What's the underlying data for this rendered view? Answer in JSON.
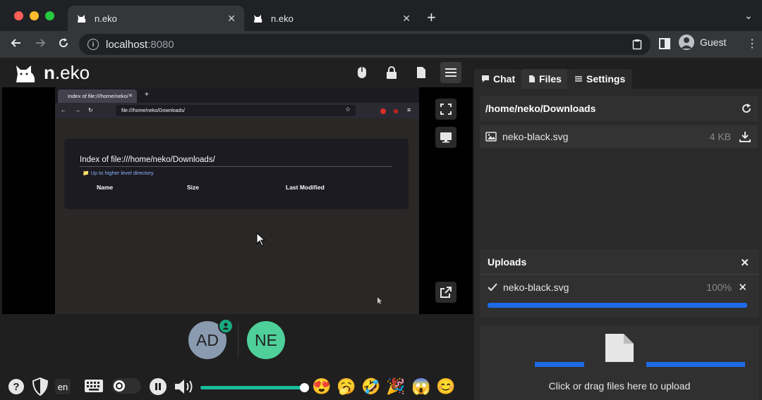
{
  "browser": {
    "tabs": [
      {
        "title": "n.eko",
        "active": true
      },
      {
        "title": "n.eko",
        "active": false
      }
    ],
    "url_host": "localhost",
    "url_port": ":8080",
    "profile": "Guest"
  },
  "app": {
    "logo_bold": "n",
    "logo_rest": ".eko",
    "remote_browser": {
      "tab_title": "Index of file:///home/neko/",
      "url": "file:///home/neko/Downloads/",
      "page_title": "Index of file:///home/neko/Downloads/",
      "up_link": "Up to higher level directory",
      "columns": [
        "Name",
        "Size",
        "Last Modified"
      ]
    },
    "members": [
      {
        "initials": "AD",
        "color": "#8a9bb0"
      },
      {
        "initials": "NE",
        "color": "#4fd09a"
      }
    ],
    "language": "en",
    "volume_fraction": 1.0,
    "emojis": [
      "😍",
      "🥱",
      "🤣",
      "🎉",
      "😱",
      "😊"
    ]
  },
  "panel": {
    "tabs": {
      "chat": "Chat",
      "files": "Files",
      "settings": "Settings"
    },
    "path": "/home/neko/Downloads",
    "files": [
      {
        "name": "neko-black.svg",
        "size": "4 KB"
      }
    ],
    "uploads": {
      "title": "Uploads",
      "items": [
        {
          "name": "neko-black.svg",
          "percent": "100%"
        }
      ]
    },
    "dropzone_label": "Click or drag files here to upload"
  }
}
